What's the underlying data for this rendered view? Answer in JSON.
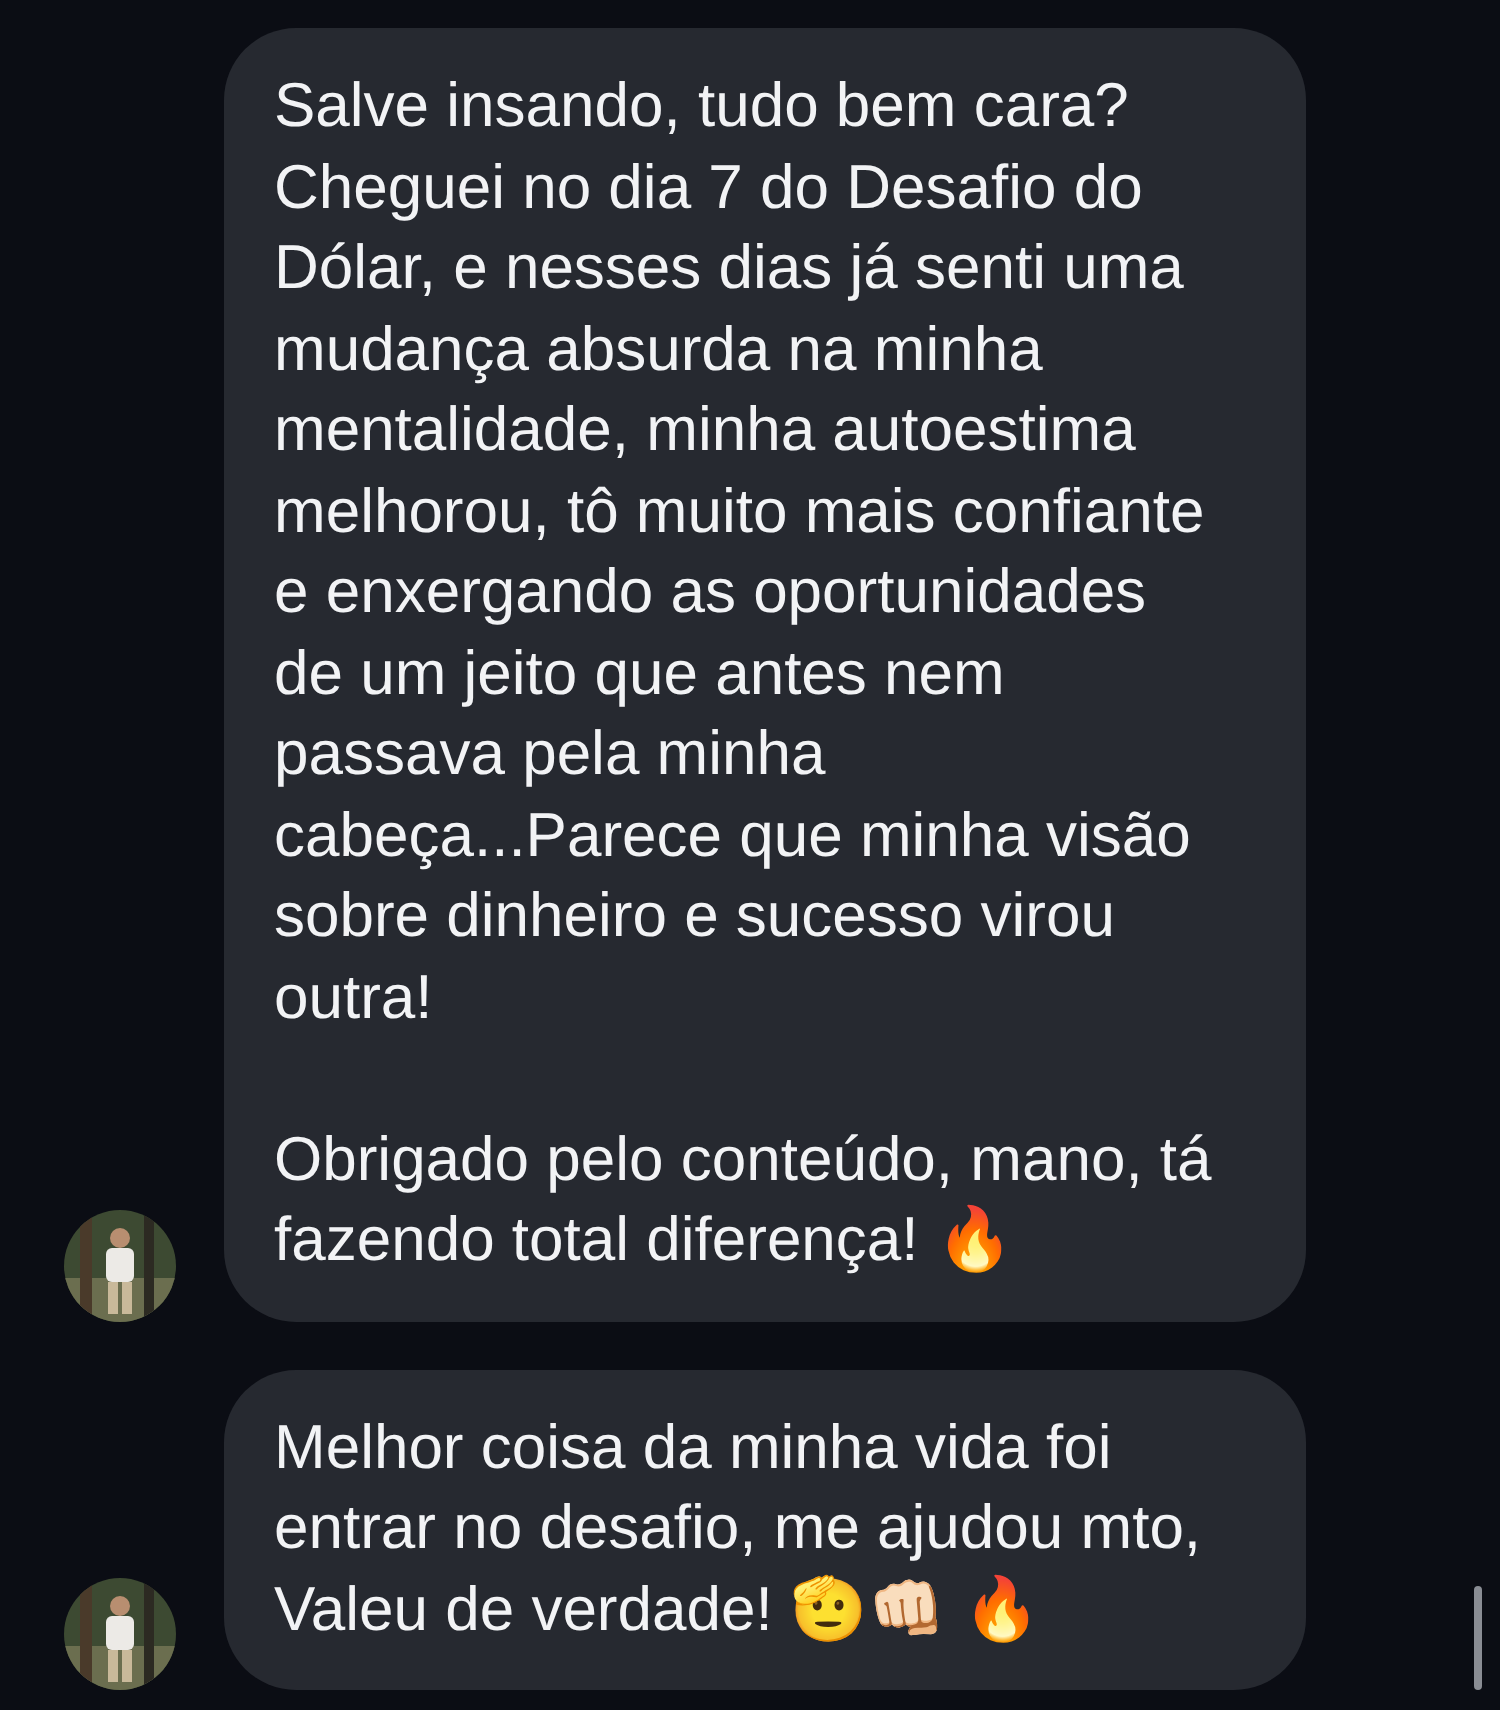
{
  "messages": [
    {
      "text": "Salve insando, tudo bem cara?\nCheguei no dia 7 do Desafio do\nDólar, e nesses dias já senti uma\nmudança absurda na minha\nmentalidade, minha autoestima\nmelhorou, tô muito mais confiante\ne enxergando as oportunidades\nde um jeito que antes nem\npassava pela minha\ncabeça...Parece que minha visão\nsobre dinheiro e sucesso virou\noutra!\n\nObrigado pelo conteúdo, mano, tá\nfazendo total diferença! 🔥",
      "avatar": true
    },
    {
      "text": "Melhor coisa da minha vida foi\nentrar no desafio, me ajudou mto,\nValeu de verdade! 🫡👊🏻 🔥",
      "avatar": true
    }
  ]
}
